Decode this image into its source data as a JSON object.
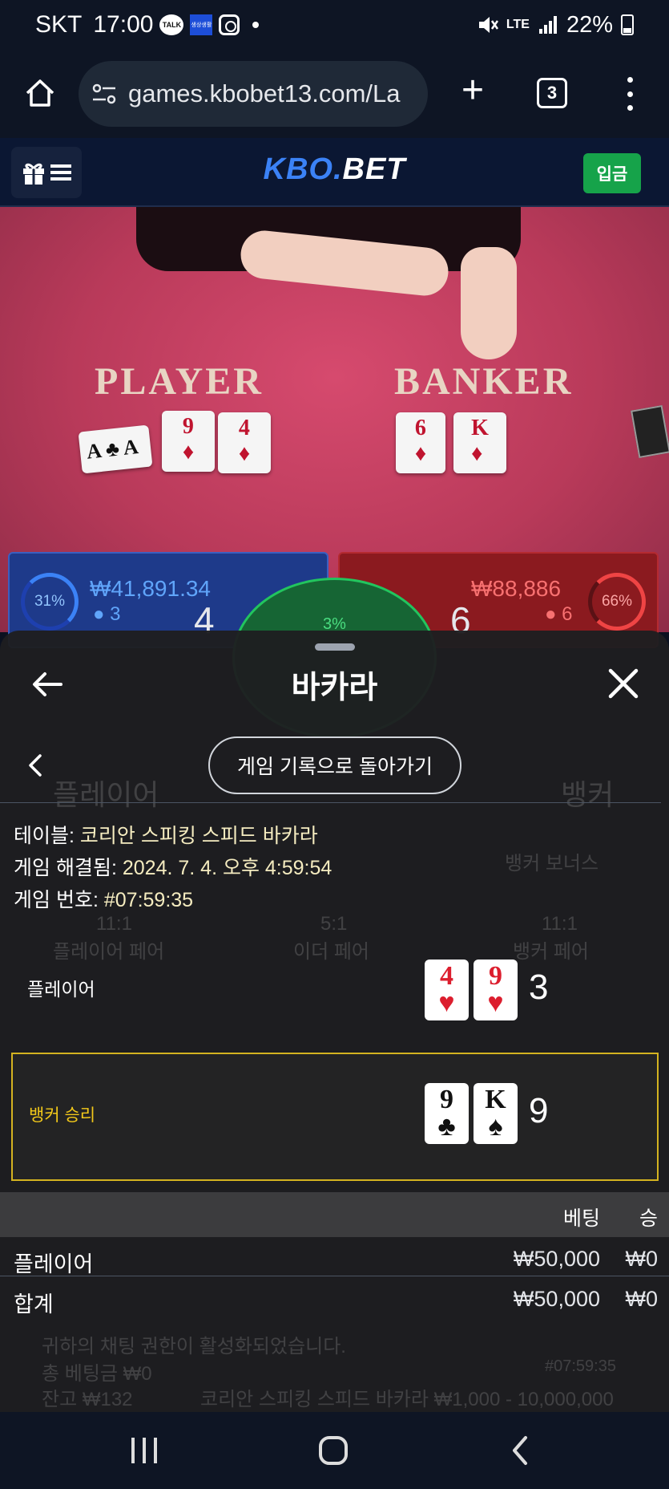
{
  "status_bar": {
    "carrier": "SKT",
    "time": "17:00",
    "talk_badge": "TALK",
    "app_badge": "생상생활",
    "network": "LTE",
    "battery": "22%"
  },
  "browser": {
    "url": "games.kbobet13.com/La",
    "tab_count": "3"
  },
  "site": {
    "logo_part1": "KBO.",
    "logo_part2": "BET",
    "deposit_label": "입금"
  },
  "table": {
    "player_word": "PLAYER",
    "banker_word": "BANKER",
    "player_cards": [
      "A♣",
      "9♦",
      "4♦"
    ],
    "banker_cards": [
      "6♦",
      "K♦"
    ],
    "player_panel": {
      "pct": "31%",
      "amount": "₩41,891.34",
      "count": "3",
      "score": "4"
    },
    "banker_panel": {
      "pct": "66%",
      "amount": "₩88,886",
      "count": "6",
      "score": "6"
    },
    "tie_pct": "3%"
  },
  "sheet": {
    "title": "바카라",
    "history_button": "게임 기록으로 돌아가기",
    "info": {
      "table_key": "테이블:",
      "table_val": "코리안 스피킹 스피드 바카라",
      "resolved_key": "게임 해결됨:",
      "resolved_val": "2024. 7. 4. 오후 4:59:54",
      "number_key": "게임 번호:",
      "number_val": "#07:59:35"
    },
    "player_row": {
      "label": "플레이어",
      "cards": [
        {
          "rank": "4",
          "suit": "♥",
          "color": "#dc1e2e"
        },
        {
          "rank": "9",
          "suit": "♥",
          "color": "#dc1e2e"
        }
      ],
      "score": "3"
    },
    "banker_row": {
      "label": "뱅커 승리",
      "cards": [
        {
          "rank": "9",
          "suit": "♣",
          "color": "#111111"
        },
        {
          "rank": "K",
          "suit": "♠",
          "color": "#111111"
        }
      ],
      "score": "9"
    },
    "bets_header": {
      "bet": "베팅",
      "win": "승"
    },
    "bets": [
      {
        "label": "플레이어",
        "bet": "₩50,000",
        "win": "₩0"
      }
    ],
    "total": {
      "label": "합계",
      "bet": "₩50,000",
      "win": "₩0"
    },
    "ghost_text": {
      "left_header": "플레이어",
      "right_header": "뱅커",
      "banker_bonus": "뱅커 보너스",
      "player_pair_odds": "11:1",
      "player_pair": "플레이어 페어",
      "either_pair_odds": "5:1",
      "either_pair": "이더 페어",
      "banker_pair_odds": "11:1",
      "banker_pair": "뱅커 페어",
      "notice": "귀하의 채팅 권한이 활성화되었습니다.",
      "total_bet": "총 베팅금 ₩0",
      "balance": "잔고 ₩132",
      "table_limit": "코리안 스피킹 스피드 바카라 ₩1,000 - 10,000,000",
      "game_no": "#07:59:35"
    }
  }
}
